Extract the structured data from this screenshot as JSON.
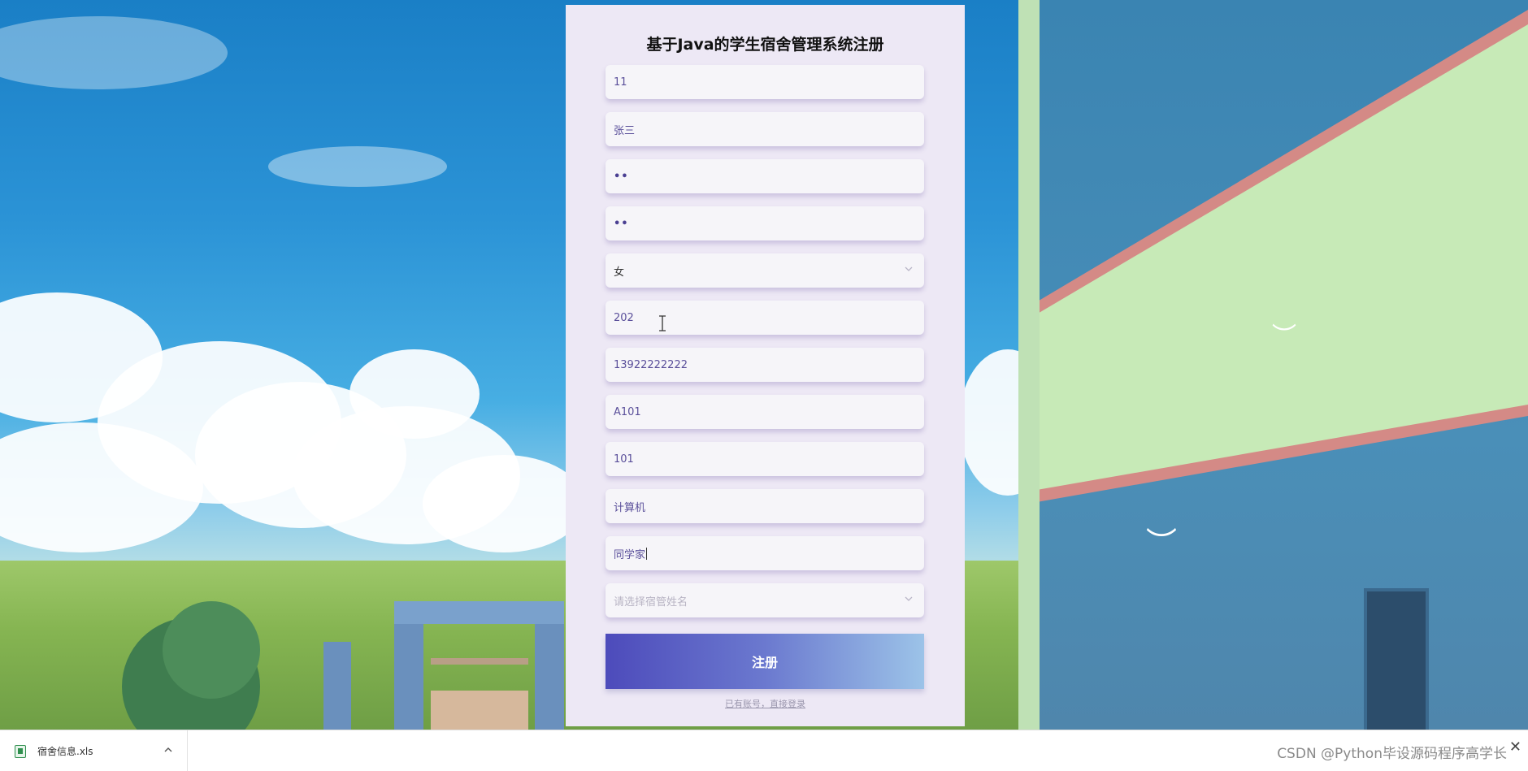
{
  "register_form": {
    "title": "基于Java的学生宿舍管理系统注册",
    "fields": {
      "account": {
        "value": "11"
      },
      "name": {
        "value": "张三"
      },
      "password": {
        "value": "••"
      },
      "confirm_password": {
        "value": "••"
      },
      "gender": {
        "value": "女"
      },
      "age": {
        "value": "202"
      },
      "phone": {
        "value": "13922222222"
      },
      "building": {
        "value": "A101"
      },
      "room": {
        "value": "101"
      },
      "major": {
        "value": "计算机"
      },
      "class": {
        "value": "同学家"
      },
      "dorm_manager": {
        "placeholder": "请选择宿管姓名"
      }
    },
    "submit_label": "注册",
    "login_link": "已有账号，直接登录"
  },
  "download_bar": {
    "file_name": "宿舍信息.xls",
    "watermark": "CSDN @Python毕设源码程序高学长"
  },
  "colors": {
    "panel_bg": "#ede8f5",
    "field_text": "#5a4f9a",
    "button_gradient_start": "#4d4bbb",
    "button_gradient_end": "#9cc3e8"
  }
}
